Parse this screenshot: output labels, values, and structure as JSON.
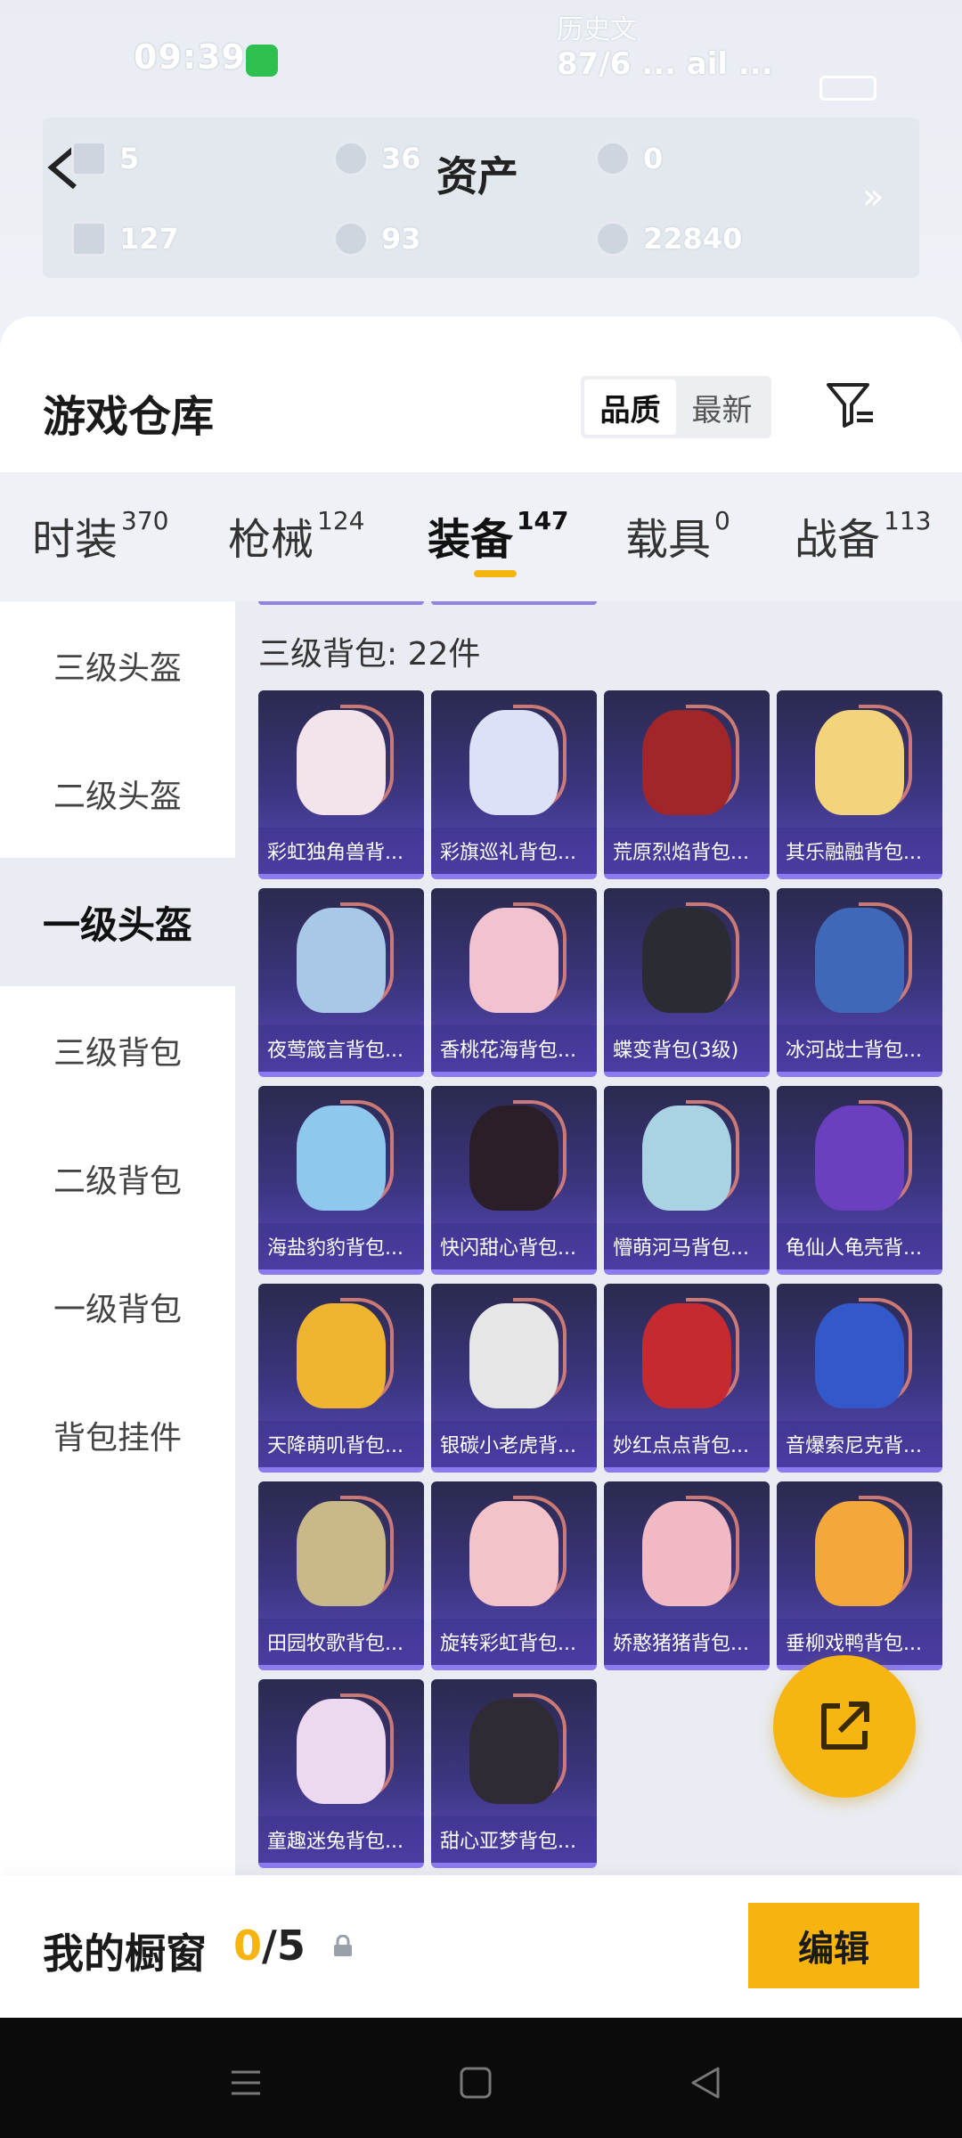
{
  "status_bar": {
    "time": "09:39",
    "right_line1": "历史文",
    "right_line2": "87/6 ... ail ..."
  },
  "assets": {
    "title": "资产",
    "items": [
      {
        "icon": "ticket-icon",
        "value": "5"
      },
      {
        "icon": "silver-coin-icon",
        "value": "36"
      },
      {
        "icon": "bronze-coin-icon",
        "value": "0"
      },
      {
        "icon": "card-icon",
        "value": "127"
      },
      {
        "icon": "grey-coin-icon",
        "value": "93"
      },
      {
        "icon": "copper-coin-icon",
        "value": "22840"
      }
    ],
    "more": "»"
  },
  "warehouse": {
    "title": "游戏仓库",
    "sort_options": [
      "品质",
      "最新"
    ],
    "active_sort": "品质"
  },
  "tabs": [
    {
      "label": "时装",
      "count": "370"
    },
    {
      "label": "枪械",
      "count": "124"
    },
    {
      "label": "装备",
      "count": "147"
    },
    {
      "label": "载具",
      "count": "0"
    },
    {
      "label": "战备",
      "count": "113"
    }
  ],
  "active_tab": "装备",
  "categories": [
    "三级头盔",
    "二级头盔",
    "一级头盔",
    "三级背包",
    "二级背包",
    "一级背包",
    "背包挂件"
  ],
  "active_category": "一级头盔",
  "section": {
    "title": "三级背包: 22件"
  },
  "items": [
    {
      "name": "彩虹独角兽背...",
      "color": "#f3e3ea"
    },
    {
      "name": "彩旗巡礼背包...",
      "color": "#dde1f7"
    },
    {
      "name": "荒原烈焰背包...",
      "color": "#a0262a"
    },
    {
      "name": "其乐融融背包...",
      "color": "#f4d47a"
    },
    {
      "name": "夜莺箴言背包...",
      "color": "#a9c8e8"
    },
    {
      "name": "香桃花海背包...",
      "color": "#f2c3cf"
    },
    {
      "name": "蝶变背包(3级)",
      "color": "#2b2b33"
    },
    {
      "name": "冰河战士背包...",
      "color": "#3f68b8"
    },
    {
      "name": "海盐豹豹背包...",
      "color": "#8fc8ec"
    },
    {
      "name": "快闪甜心背包...",
      "color": "#2a1f28"
    },
    {
      "name": "懵萌河马背包...",
      "color": "#a9d2e3"
    },
    {
      "name": "龟仙人龟壳背...",
      "color": "#6a3fc0"
    },
    {
      "name": "天降萌叽背包...",
      "color": "#f0b530"
    },
    {
      "name": "银碳小老虎背...",
      "color": "#e6e6e6"
    },
    {
      "name": "妙红点点背包...",
      "color": "#c42a2f"
    },
    {
      "name": "音爆索尼克背...",
      "color": "#3358c9"
    },
    {
      "name": "田园牧歌背包...",
      "color": "#c9b888"
    },
    {
      "name": "旋转彩虹背包...",
      "color": "#f4c2c9"
    },
    {
      "name": "娇憨猪猪背包...",
      "color": "#f1b9c4"
    },
    {
      "name": "垂柳戏鸭背包...",
      "color": "#f5a83a"
    },
    {
      "name": "童趣迷兔背包...",
      "color": "#ecd9f0"
    },
    {
      "name": "甜心亚梦背包...",
      "color": "#2f2a33"
    }
  ],
  "showcase": {
    "title": "我的橱窗",
    "current": "0",
    "total": "/5",
    "edit_label": "编辑"
  },
  "colors": {
    "accent": "#f7b40f",
    "card_purple": "#3c3580"
  }
}
